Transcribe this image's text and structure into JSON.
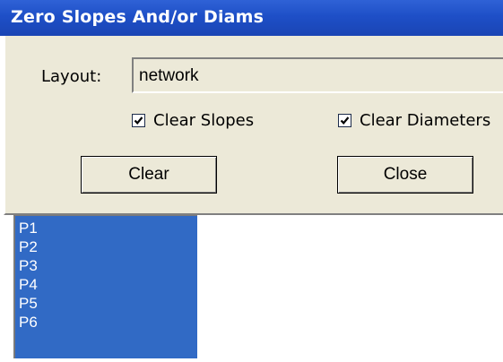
{
  "window": {
    "title": "Zero Slopes And/or  Diams"
  },
  "form": {
    "layout_label": "Layout:",
    "layout_value": "network",
    "clear_slopes_label": "Clear Slopes",
    "clear_slopes_checked": true,
    "clear_diameters_label": "Clear Diameters",
    "clear_diameters_checked": true
  },
  "buttons": {
    "clear": "Clear",
    "close": "Close"
  },
  "list": {
    "items": [
      {
        "label": "P1"
      },
      {
        "label": "P2"
      },
      {
        "label": "P3"
      },
      {
        "label": "P4"
      },
      {
        "label": "P5"
      },
      {
        "label": "P6"
      }
    ]
  },
  "colors": {
    "titlebar": "#1e4fc7",
    "dialog_bg": "#ece9d8",
    "list_selection": "#316ac5"
  }
}
